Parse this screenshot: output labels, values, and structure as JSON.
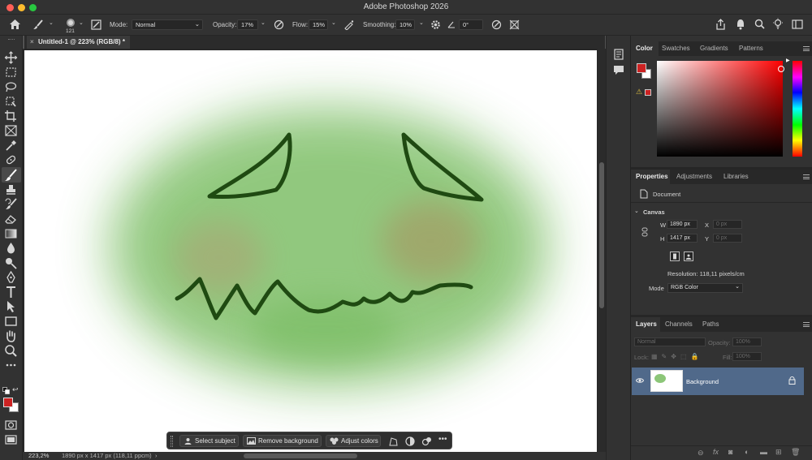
{
  "app": {
    "title": "Adobe Photoshop 2026"
  },
  "options": {
    "brush_size": "121",
    "mode_label": "Mode:",
    "mode_value": "Normal",
    "opacity_label": "Opacity:",
    "opacity_value": "17%",
    "flow_label": "Flow:",
    "flow_value": "15%",
    "smoothing_label": "Smoothing:",
    "smoothing_value": "10%",
    "angle_value": "0°"
  },
  "document": {
    "tab_title": "Untitled-1 @ 223% (RGB/8) *"
  },
  "status": {
    "zoom": "223,2%",
    "info": "1890 px x 1417 px (118,11 ppcm)"
  },
  "context_bar": {
    "select_subject": "Select subject",
    "remove_background": "Remove background",
    "adjust_colors": "Adjust colors"
  },
  "color_panel": {
    "tabs": [
      "Color",
      "Swatches",
      "Gradients",
      "Patterns"
    ],
    "foreground": "#cc2222",
    "background": "#ffffff"
  },
  "properties_panel": {
    "tabs": [
      "Properties",
      "Adjustments",
      "Libraries"
    ],
    "document_label": "Document",
    "canvas_heading": "Canvas",
    "w_label": "W",
    "w_value": "1890 px",
    "h_label": "H",
    "h_value": "1417 px",
    "x_label": "X",
    "x_value": "0 px",
    "y_label": "Y",
    "y_value": "0 px",
    "resolution": "Resolution: 118,11 pixels/cm",
    "mode_label": "Mode",
    "mode_value": "RGB Color"
  },
  "layers_panel": {
    "tabs": [
      "Layers",
      "Channels",
      "Paths"
    ],
    "blend_mode": "Normal",
    "opacity_label": "Opacity:",
    "opacity_value": "100%",
    "lock_label": "Lock:",
    "fill_label": "Fill:",
    "fill_value": "100%",
    "layers": [
      {
        "name": "Background",
        "visible": true,
        "locked": true
      }
    ]
  },
  "colors": {
    "accent_layer": "#50698a",
    "blob_green": "#8cc678",
    "stroke_dark_green": "#1f4a12"
  }
}
